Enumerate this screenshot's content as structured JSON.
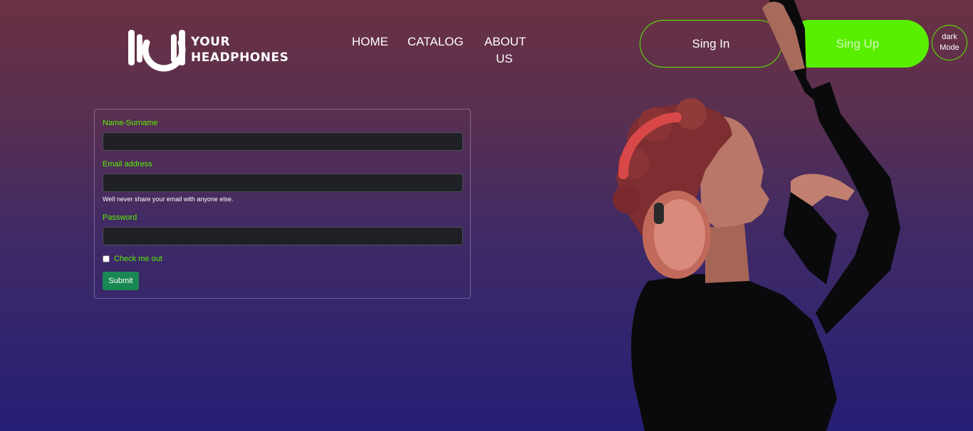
{
  "brand": {
    "line1": "YOUR",
    "line2": "HEADPHONES",
    "accent_color": "#58f000"
  },
  "nav": {
    "home": "HOME",
    "catalog": "CATALOG",
    "about_line1": "ABOUT",
    "about_line2": "US"
  },
  "auth": {
    "sign_in": "Sing In",
    "sign_up": "Sing Up",
    "dark_mode_line1": "dark",
    "dark_mode_line2": "Mode"
  },
  "form": {
    "name_label": "Name-Surname",
    "name_value": "",
    "email_label": "Email address",
    "email_value": "",
    "email_help": "Well never share your email with anyone else.",
    "password_label": "Password",
    "password_value": "",
    "check_label": "Check me out",
    "checked": false,
    "submit_label": "Submit",
    "submit_color": "#198754"
  },
  "hero": {
    "icon": "woman-with-headphones-illustration"
  }
}
